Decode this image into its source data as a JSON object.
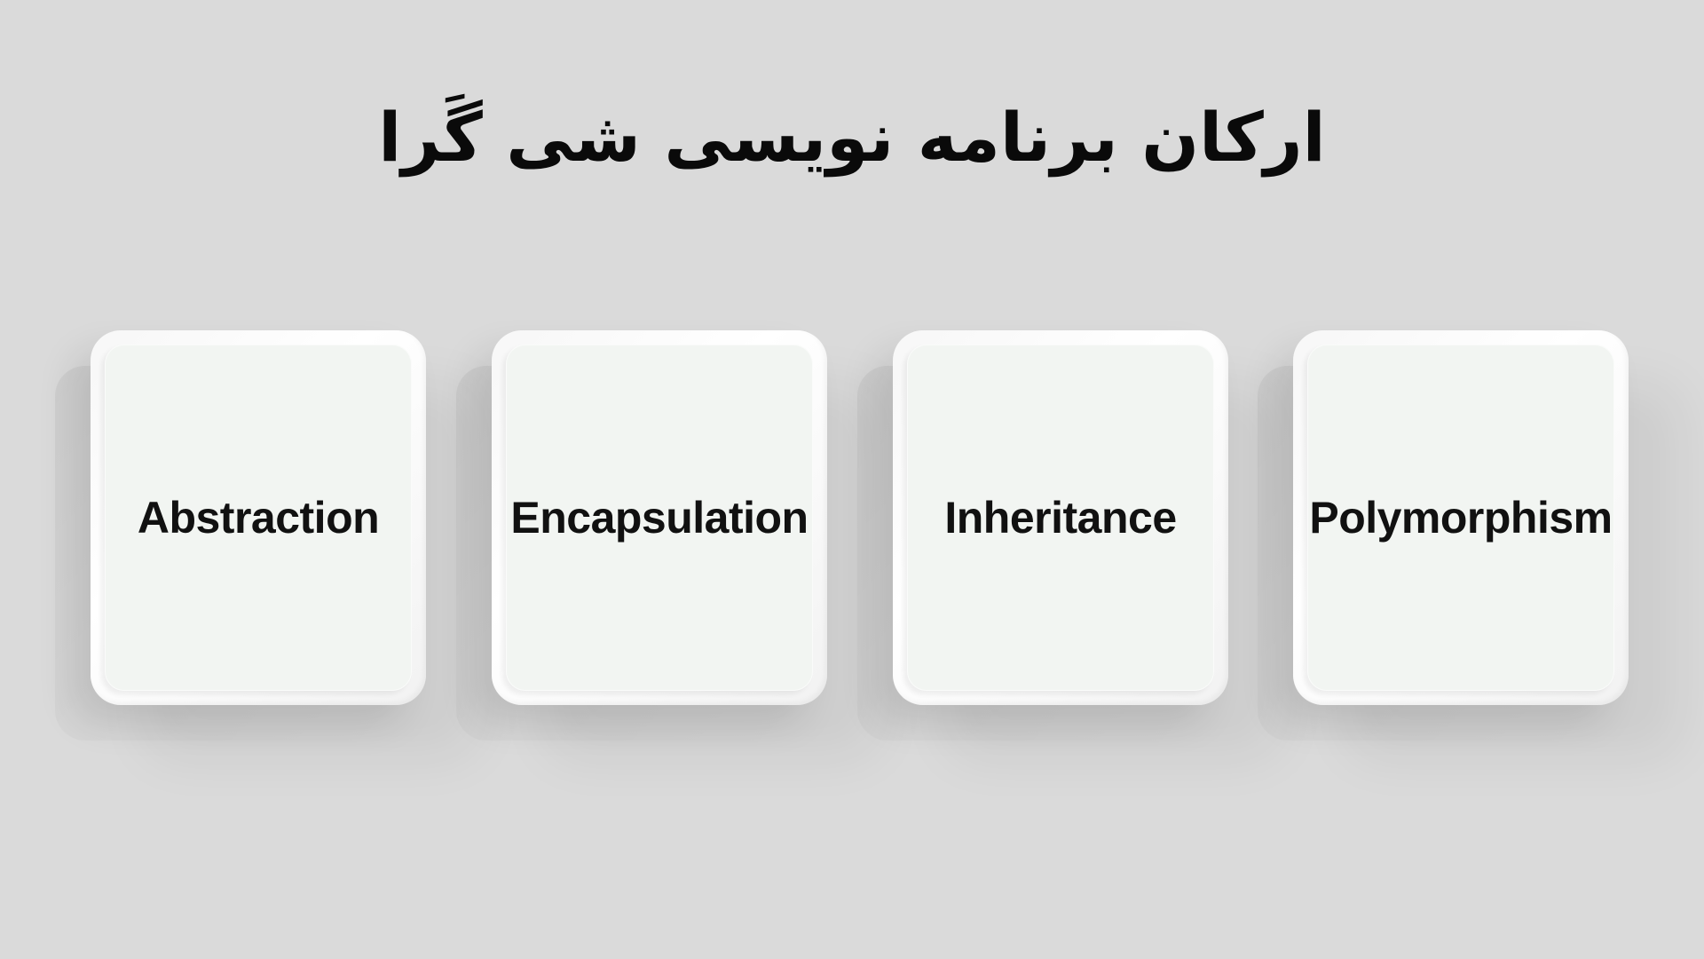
{
  "title": "ارکان برنامه نویسی شی گَرا",
  "cards": [
    {
      "label": "Abstraction"
    },
    {
      "label": "Encapsulation"
    },
    {
      "label": "Inheritance"
    },
    {
      "label": "Polymorphism"
    }
  ],
  "colors": {
    "background": "#dadada",
    "card_face": "#f2f5f2",
    "text": "#111111"
  }
}
